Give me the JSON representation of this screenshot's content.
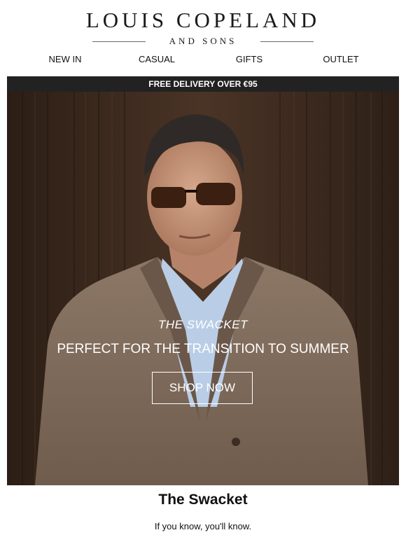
{
  "brand": {
    "name": "LOUIS COPELAND",
    "tagline": "AND SONS"
  },
  "nav": {
    "items": [
      {
        "label": "NEW IN"
      },
      {
        "label": "CASUAL"
      },
      {
        "label": "GIFTS"
      },
      {
        "label": "OUTLET"
      }
    ]
  },
  "promo_bar": {
    "text": "FREE DELIVERY OVER €95"
  },
  "hero": {
    "kicker": "THE SWACKET",
    "headline": "PERFECT FOR THE TRANSITION TO SUMMER",
    "cta_label": "SHOP NOW"
  },
  "section": {
    "title": "The Swacket",
    "subtitle": "If you know, you'll know."
  },
  "colors": {
    "promo_bar_bg": "#222222",
    "hero_text": "#ffffff"
  }
}
